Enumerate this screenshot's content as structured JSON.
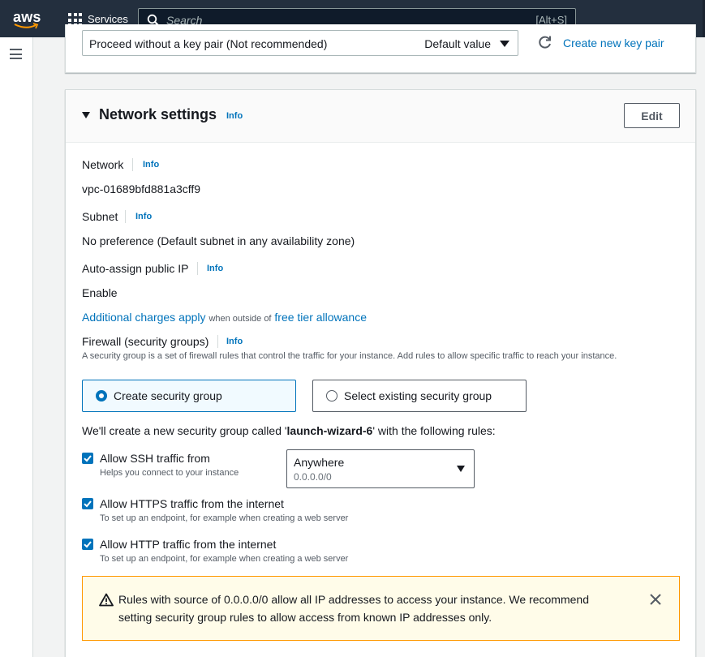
{
  "topnav": {
    "logo_text": "aws",
    "services_label": "Services",
    "search_placeholder": "Search",
    "search_shortcut": "[Alt+S]"
  },
  "key_pair": {
    "selected_value": "Proceed without a key pair (Not recommended)",
    "default_tag": "Default value",
    "create_link": "Create new key pair"
  },
  "network_settings": {
    "title": "Network settings",
    "info": "Info",
    "edit_label": "Edit",
    "network": {
      "label": "Network",
      "info": "Info",
      "value": "vpc-01689bfd881a3cff9"
    },
    "subnet": {
      "label": "Subnet",
      "info": "Info",
      "value": "No preference (Default subnet in any availability zone)"
    },
    "public_ip": {
      "label": "Auto-assign public IP",
      "info": "Info",
      "value": "Enable"
    },
    "charges": {
      "link1": "Additional charges apply",
      "middle": "when outside of",
      "link2": "free tier allowance"
    },
    "firewall": {
      "label": "Firewall (security groups)",
      "info": "Info",
      "description": "A security group is a set of firewall rules that control the traffic for your instance. Add rules to allow specific traffic to reach your instance.",
      "options": [
        {
          "label": "Create security group",
          "selected": true
        },
        {
          "label": "Select existing security group",
          "selected": false
        }
      ]
    },
    "sg_sentence": {
      "prefix": "We'll create a new security group called '",
      "name": "launch-wizard-6",
      "suffix": "' with the following rules:"
    },
    "rules": [
      {
        "label": "Allow SSH traffic from",
        "hint": "Helps you connect to your instance",
        "checked": true
      },
      {
        "label": "Allow HTTPS traffic from the internet",
        "hint": "To set up an endpoint, for example when creating a web server",
        "checked": true
      },
      {
        "label": "Allow HTTP traffic from the internet",
        "hint": "To set up an endpoint, for example when creating a web server",
        "checked": true
      }
    ],
    "ssh_source": {
      "value": "Anywhere",
      "cidr": "0.0.0.0/0"
    },
    "warning": {
      "text": "Rules with source of 0.0.0.0/0 allow all IP addresses to access your instance. We recommend setting security group rules to allow access from known IP addresses only."
    }
  },
  "colors": {
    "nav_bg": "#232f3e",
    "link": "#0073bb",
    "warning_border": "#ff9900",
    "warning_bg": "#fffce9"
  }
}
